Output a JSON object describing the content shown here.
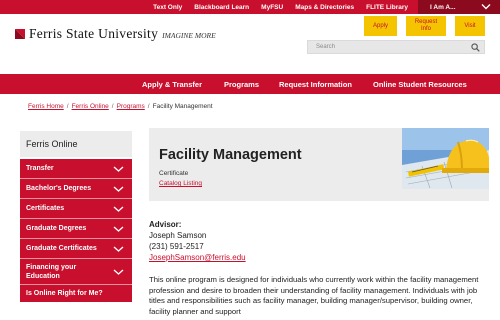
{
  "utility": {
    "links": [
      "Text Only",
      "Blackboard Learn",
      "MyFSU",
      "Maps & Directories",
      "FLITE Library"
    ],
    "iam_label": "I Am A..."
  },
  "brand": {
    "name": "Ferris State University",
    "tagline": "IMAGINE MORE",
    "red": "#c8102e",
    "dark_red": "#8b0a1e",
    "gold": "#f4c400"
  },
  "header": {
    "apply": "Apply",
    "request_info": "Request Info",
    "visit": "Visit"
  },
  "search": {
    "placeholder": "Search"
  },
  "main_nav": [
    "Apply & Transfer",
    "Programs",
    "Request Information",
    "Online Student Resources"
  ],
  "breadcrumb": {
    "home": "Ferris Home",
    "online": "Ferris Online",
    "programs": "Programs",
    "current": "Facility Management"
  },
  "sidebar": {
    "title": "Ferris Online",
    "items": [
      "Transfer",
      "Bachelor's Degrees",
      "Certificates",
      "Graduate Degrees",
      "Graduate Certificates",
      "Financing your Education",
      "Is Online Right for Me?"
    ]
  },
  "program": {
    "title": "Facility Management",
    "type": "Certificate",
    "catalog_link": "Catalog Listing"
  },
  "advisor": {
    "heading": "Advisor:",
    "name": "Joseph Samson",
    "phone": "(231) 591-2517",
    "email": "JosephSamson@ferris.edu"
  },
  "description": "This online program is designed for individuals who currently work within the facility management profession and desire to broaden their understanding of facility management. Individuals with job titles and responsibilities such as facility manager, building manager/supervisor, building owner, facility planner and support"
}
